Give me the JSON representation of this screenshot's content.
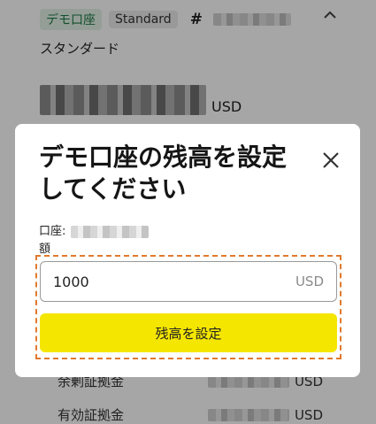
{
  "account": {
    "demo_badge": "デモ口座",
    "type_badge": "Standard",
    "number_prefix": "#",
    "type_name": "スタンダード",
    "balance_currency": "USD",
    "free_margin_label": "余剰証拠金",
    "free_margin_currency": "USD",
    "effective_margin_label": "有効証拠金",
    "effective_margin_currency": "USD"
  },
  "modal": {
    "title": "デモ口座の残高を設定してください",
    "account_label": "口座:",
    "account_label_tail": "額",
    "amount_value": "1000",
    "amount_currency": "USD",
    "submit_label": "残高を設定"
  },
  "colors": {
    "primary_button": "#f5e600",
    "focus_outline": "#e07a2e",
    "demo_badge_text": "#1d7a44"
  },
  "icons": {
    "close": "close-icon",
    "collapse": "chevron-up-icon"
  }
}
